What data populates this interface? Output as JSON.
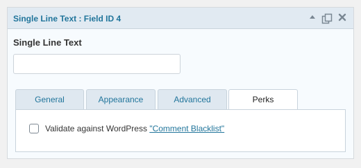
{
  "header": {
    "title": "Single Line Text : Field ID 4",
    "icons": [
      "collapse-arrow-icon",
      "duplicate-icon",
      "close-icon"
    ]
  },
  "field": {
    "label": "Single Line Text",
    "value": "",
    "placeholder": ""
  },
  "tabs": [
    {
      "label": "General",
      "active": false
    },
    {
      "label": "Appearance",
      "active": false
    },
    {
      "label": "Advanced",
      "active": false
    },
    {
      "label": "Perks",
      "active": true
    }
  ],
  "perks": {
    "checkbox_label": "Validate against WordPress ",
    "checkbox_link": "\"Comment Blacklist\"",
    "checked": false
  },
  "colors": {
    "accent": "#21759b",
    "header_bg": "#e1eaf2",
    "tab_bg": "#dfe8f0"
  }
}
